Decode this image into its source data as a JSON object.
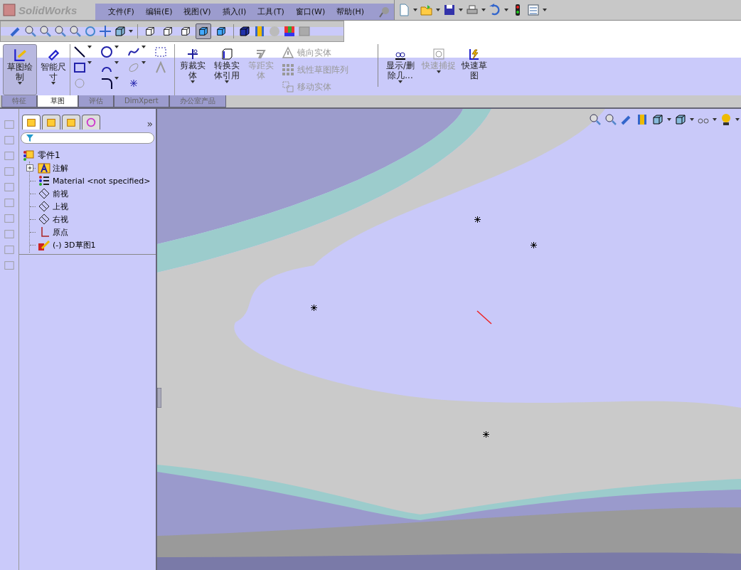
{
  "app": {
    "logo": "SolidWorks"
  },
  "menu": [
    {
      "label": "文件(F)"
    },
    {
      "label": "编辑(E)"
    },
    {
      "label": "视图(V)"
    },
    {
      "label": "插入(I)"
    },
    {
      "label": "工具(T)"
    },
    {
      "label": "窗口(W)"
    },
    {
      "label": "帮助(H)"
    }
  ],
  "display_styles": [
    {
      "selected": false
    },
    {
      "selected": false
    },
    {
      "selected": false
    },
    {
      "selected": true
    },
    {
      "selected": false
    }
  ],
  "command_manager": {
    "sketch_button": {
      "label": "草图绘制",
      "selected": true
    },
    "dimension_button": {
      "label": "智能尺寸"
    },
    "large_tools": [
      {
        "label": "剪裁实体",
        "disabled": false,
        "kind": "trim"
      },
      {
        "label": "转换实体引用",
        "disabled": false,
        "kind": "convert"
      },
      {
        "label": "等距实体",
        "disabled": true,
        "kind": "offset"
      }
    ],
    "small_tools": [
      {
        "label": "镜向实体",
        "disabled": true,
        "kind": "mirror"
      },
      {
        "label": "线性草图阵列",
        "disabled": true,
        "kind": "pattern"
      },
      {
        "label": "移动实体",
        "disabled": true,
        "kind": "move"
      }
    ],
    "right_tools": [
      {
        "label": "显示/删除几...",
        "disabled": false,
        "kind": "relations"
      },
      {
        "label": "快速捕捉",
        "disabled": true,
        "kind": "snap"
      },
      {
        "label": "快速草图",
        "disabled": false,
        "kind": "quick"
      }
    ]
  },
  "tabs": [
    {
      "label": "特征",
      "selected": false
    },
    {
      "label": "草图",
      "selected": true
    },
    {
      "label": "评估",
      "selected": false
    },
    {
      "label": "DimXpert",
      "selected": false
    },
    {
      "label": "办公室产品",
      "selected": false
    }
  ],
  "panel_tabs": [
    {
      "selected": true
    },
    {
      "selected": false
    },
    {
      "selected": false
    },
    {
      "selected": false
    }
  ],
  "panel_expand": "»",
  "feature_tree": {
    "label": "零件1",
    "children": [
      {
        "label": "注解",
        "kind": "annotations",
        "expanded": false
      },
      {
        "label": "Material <not specified>",
        "kind": "material"
      },
      {
        "label": "前视",
        "kind": "plane"
      },
      {
        "label": "上视",
        "kind": "plane"
      },
      {
        "label": "右视",
        "kind": "plane"
      },
      {
        "label": "原点",
        "kind": "origin"
      },
      {
        "label": "(-) 3D草图1",
        "kind": "sketch"
      }
    ]
  }
}
